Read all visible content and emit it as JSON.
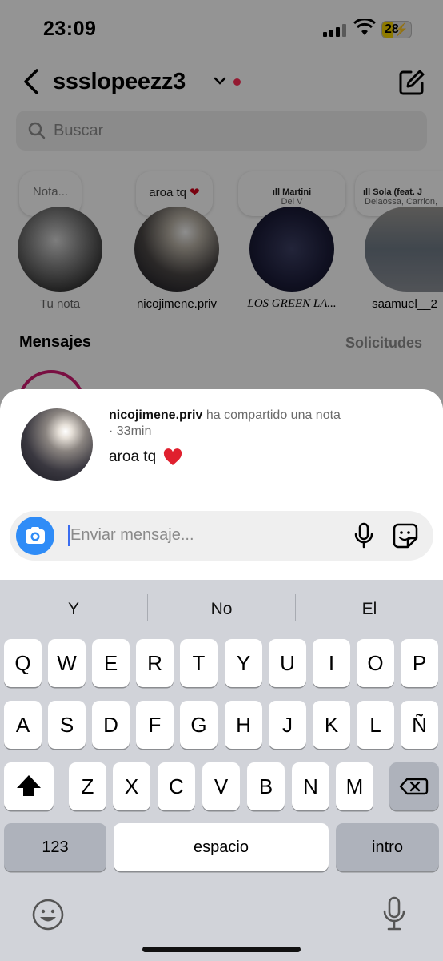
{
  "status_bar": {
    "time": "23:09",
    "battery": "28"
  },
  "header": {
    "username": "ssslopeezz3"
  },
  "search": {
    "placeholder": "Buscar"
  },
  "notes": [
    {
      "bubble": "Nota...",
      "name": "Tu nota"
    },
    {
      "bubble": "aroa tq",
      "name": "nicojimene.priv"
    },
    {
      "song_title": "Martini",
      "song_artist": "Del V",
      "name": "LOS GREEN LA..."
    },
    {
      "song_title": "Sola (feat. J",
      "song_artist": "Delaossa, Carrion,",
      "name": "saamuel__2"
    }
  ],
  "section": {
    "messages": "Mensajes",
    "requests": "Solicitudes"
  },
  "sheet": {
    "user": "nicojimene.priv",
    "action": "ha compartido una nota",
    "time": "· 33min",
    "note_text": "aroa tq",
    "message_placeholder": "Enviar mensaje..."
  },
  "keyboard": {
    "suggestions": [
      "Y",
      "No",
      "El"
    ],
    "row1": [
      "Q",
      "W",
      "E",
      "R",
      "T",
      "Y",
      "U",
      "I",
      "O",
      "P"
    ],
    "row2": [
      "A",
      "S",
      "D",
      "F",
      "G",
      "H",
      "J",
      "K",
      "L",
      "Ñ"
    ],
    "row3": [
      "Z",
      "X",
      "C",
      "V",
      "B",
      "N",
      "M"
    ],
    "numbers_key": "123",
    "space_key": "espacio",
    "return_key": "intro"
  }
}
